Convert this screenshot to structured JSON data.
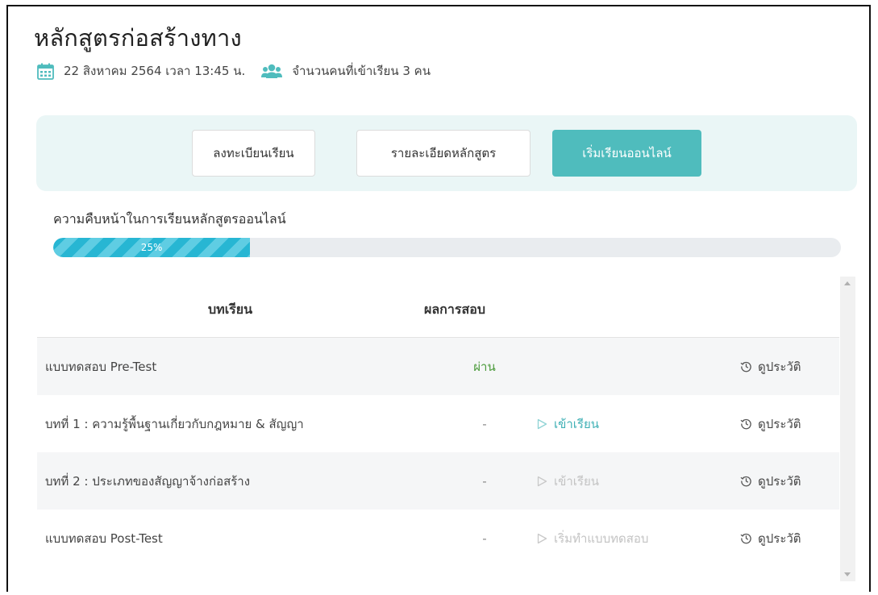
{
  "page": {
    "title": "หลักสูตรก่อสร้างทาง",
    "date_text": "22 สิงหาคม 2564 เวลา 13:45 น.",
    "attendees_text": "จำนวนคนที่เข้าเรียน 3 คน"
  },
  "tabs": {
    "register": "ลงทะเบียนเรียน",
    "details": "รายละเอียดหลักสูตร",
    "start_online": "เริ่มเรียนออนไลน์"
  },
  "progress": {
    "label": "ความคืบหน้าในการเรียนหลักสูตรออนไลน์",
    "percent": 25,
    "percent_text": "25%"
  },
  "table": {
    "headers": {
      "lesson": "บทเรียน",
      "result": "ผลการสอบ"
    },
    "rows": [
      {
        "name": "แบบทดสอบ Pre-Test",
        "result": "ผ่าน",
        "action": "",
        "history": "ดูประวัติ"
      },
      {
        "name": "บทที่ 1 : ความรู้พื้นฐานเกี่ยวกับกฎหมาย & สัญญา",
        "result": "-",
        "action": "เข้าเรียน",
        "history": "ดูประวัติ"
      },
      {
        "name": "บทที่ 2 : ประเภทของสัญญาจ้างก่อสร้าง",
        "result": "-",
        "action": "เข้าเรียน",
        "history": "ดูประวัติ"
      },
      {
        "name": "แบบทดสอบ Post-Test",
        "result": "-",
        "action": "เริ่มทำแบบทดสอบ",
        "history": "ดูประวัติ"
      }
    ]
  },
  "colors": {
    "accent": "#4fbcbd",
    "progress": "#27b6d3",
    "pass": "#4a9a3a",
    "disabled": "#c3c3c3"
  },
  "icons": {
    "date": "calendar-icon",
    "attendees": "users-icon",
    "action": "play-icon",
    "history": "history-icon"
  }
}
